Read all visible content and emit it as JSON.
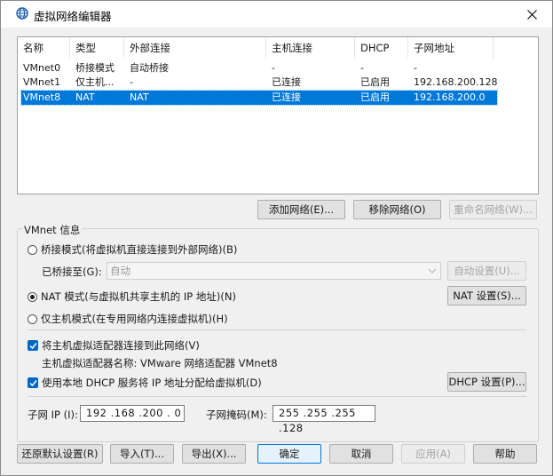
{
  "window": {
    "title": "虚拟网络编辑器"
  },
  "table": {
    "columns": [
      "名称",
      "类型",
      "外部连接",
      "主机连接",
      "DHCP",
      "子网地址"
    ],
    "rows": [
      [
        "VMnet0",
        "桥接模式",
        "自动桥接",
        "-",
        "-",
        "-"
      ],
      [
        "VMnet1",
        "仅主机...",
        "-",
        "已连接",
        "已启用",
        "192.168.200.128"
      ],
      [
        "VMnet8",
        "NAT",
        "NAT",
        "已连接",
        "已启用",
        "192.168.200.0"
      ]
    ],
    "selected_row": 2
  },
  "network_buttons": {
    "add": "添加网络(E)...",
    "remove": "移除网络(O)",
    "rename": "重命名网络(W)..."
  },
  "vmnet_info": {
    "group_title": "VMnet 信息",
    "bridge_mode": "桥接模式(将虚拟机直接连接到外部网络)(B)",
    "bridged_to_label": "已桥接至(G):",
    "bridged_to_value": "自动",
    "auto_settings": "自动设置(U)...",
    "nat_mode": "NAT 模式(与虚拟机共享主机的 IP 地址)(N)",
    "nat_settings": "NAT 设置(S)...",
    "host_only": "仅主机模式(在专用网络内连接虚拟机)(H)",
    "connect_adapter": "将主机虚拟适配器连接到此网络(V)",
    "adapter_name": "主机虚拟适配器名称: VMware 网络适配器 VMnet8",
    "use_dhcp": "使用本地 DHCP 服务将 IP 地址分配给虚拟机(D)",
    "dhcp_settings": "DHCP 设置(P)...",
    "subnet_ip_label": "子网 IP (I):",
    "subnet_ip": "192 .168 .200 .  0",
    "subnet_mask_label": "子网掩码(M):",
    "subnet_mask": "255 .255 .255 .128",
    "selected_mode": "nat",
    "connect_adapter_checked": true,
    "use_dhcp_checked": true
  },
  "footer_buttons": {
    "restore": "还原默认设置(R)",
    "import": "导入(T)...",
    "export": "导出(X)...",
    "ok": "确定",
    "cancel": "取消",
    "apply": "应用(A)",
    "help": "帮助"
  },
  "colors": {
    "selection": "#0078d7",
    "checkbox": "#0067c0",
    "background": "#f0f0f0"
  }
}
